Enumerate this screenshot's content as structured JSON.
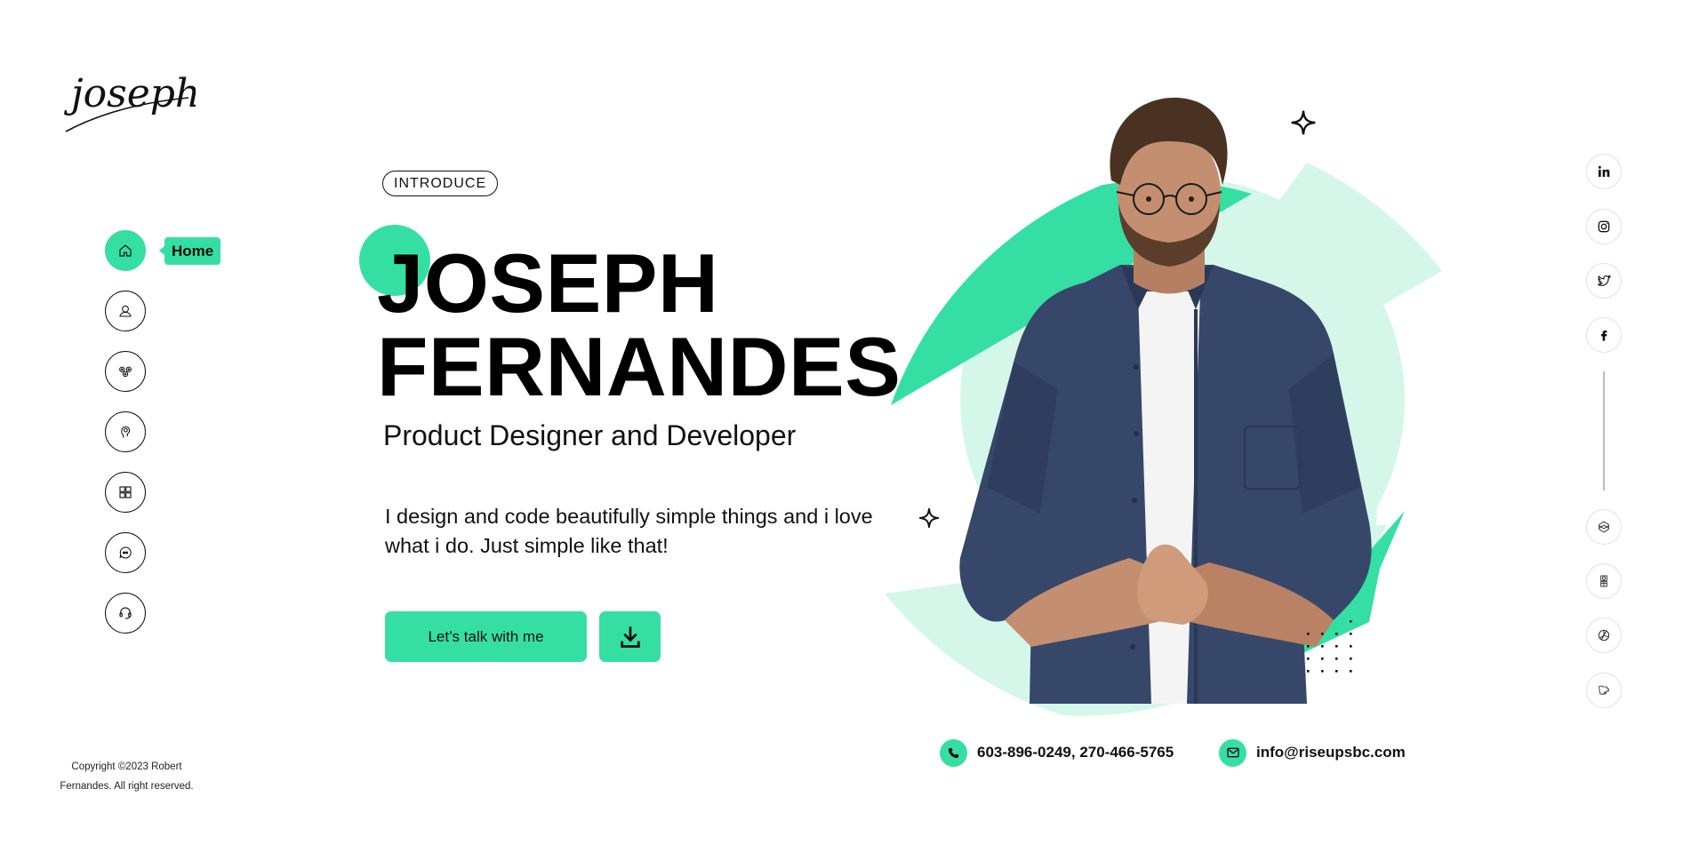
{
  "brand": {
    "logo_text": "joseph",
    "accent_color": "#35DFA3",
    "accent_light_color": "#D5F7EA"
  },
  "sidebar": {
    "items": [
      {
        "id": "home",
        "label": "Home",
        "icon": "home-icon",
        "active": true
      },
      {
        "id": "about",
        "label": "About",
        "icon": "user-icon",
        "active": false
      },
      {
        "id": "services",
        "label": "Services",
        "icon": "gears-icon",
        "active": false
      },
      {
        "id": "skills",
        "label": "Skills",
        "icon": "head-idea-icon",
        "active": false
      },
      {
        "id": "portfolio",
        "label": "Portfolio",
        "icon": "grid-icon",
        "active": false
      },
      {
        "id": "testimonials",
        "label": "Testimonials",
        "icon": "chat-quote-icon",
        "active": false
      },
      {
        "id": "contact",
        "label": "Contact",
        "icon": "headset-icon",
        "active": false
      }
    ],
    "tooltip": "Home"
  },
  "hero": {
    "badge": "INTRODUCE",
    "first_name": "JOSEPH",
    "last_name": "FERNANDES",
    "role": "Product Designer and Developer",
    "bio": "I design and code beautifully simple things and i love what i do. Just simple like that!",
    "cta_label": "Let’s talk with me",
    "download_icon": "download-icon"
  },
  "contact": {
    "phone": "603-896-0249, 270-466-5765",
    "phone_icon": "phone-icon",
    "email": "info@riseupsbc.com",
    "email_icon": "mail-icon"
  },
  "social": {
    "top": [
      {
        "name": "LinkedIn",
        "icon": "linkedin-icon"
      },
      {
        "name": "Instagram",
        "icon": "instagram-icon"
      },
      {
        "name": "Twitter",
        "icon": "twitter-icon"
      },
      {
        "name": "Facebook",
        "icon": "facebook-icon"
      }
    ],
    "bottom": [
      {
        "name": "Codepen",
        "icon": "codepen-icon"
      },
      {
        "name": "Behance",
        "icon": "behance-icon"
      },
      {
        "name": "Dribbble",
        "icon": "dribbble-icon"
      },
      {
        "name": "Mug",
        "icon": "mug-icon"
      }
    ]
  },
  "footer": {
    "copyright_line1": "Copyright ©2023 Robert",
    "copyright_line2": "Fernandes. All right reserved."
  }
}
